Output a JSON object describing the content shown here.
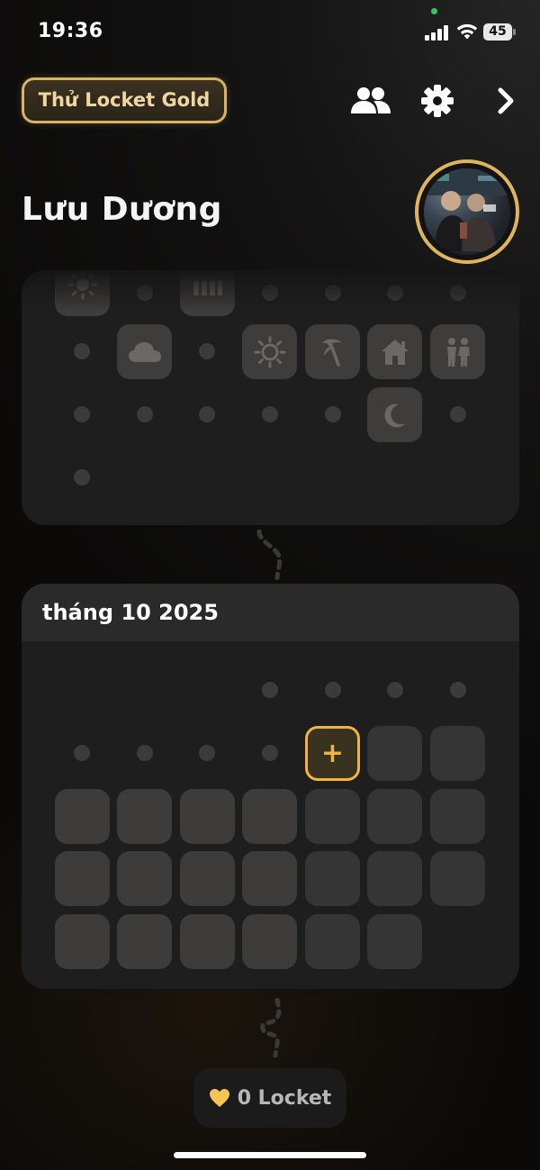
{
  "status_bar": {
    "time": "19:36",
    "battery": "45",
    "icons": [
      "signal-icon",
      "wifi-icon",
      "battery-icon"
    ]
  },
  "header": {
    "gold_button_label": "Thử Locket Gold",
    "icons": [
      "friends-icon",
      "settings-gear-icon",
      "chevron-right-icon"
    ]
  },
  "profile": {
    "name": "Lưu Dương"
  },
  "previous_month_card": {
    "icons": [
      "sun-icon",
      "calendar-grid-icon",
      "cloud-icon",
      "sun-icon",
      "palm-tree-icon",
      "home-icon",
      "couple-icon",
      "moon-icon"
    ]
  },
  "current_month_card": {
    "title": "tháng 10 2025",
    "add_button_label": "+"
  },
  "footer": {
    "locket_count_label": "0 Locket"
  },
  "colors": {
    "accent_gold": "#f0b443",
    "gold_button_border": "#d8b266",
    "background": "#121111",
    "card": "#1f1e1e"
  }
}
